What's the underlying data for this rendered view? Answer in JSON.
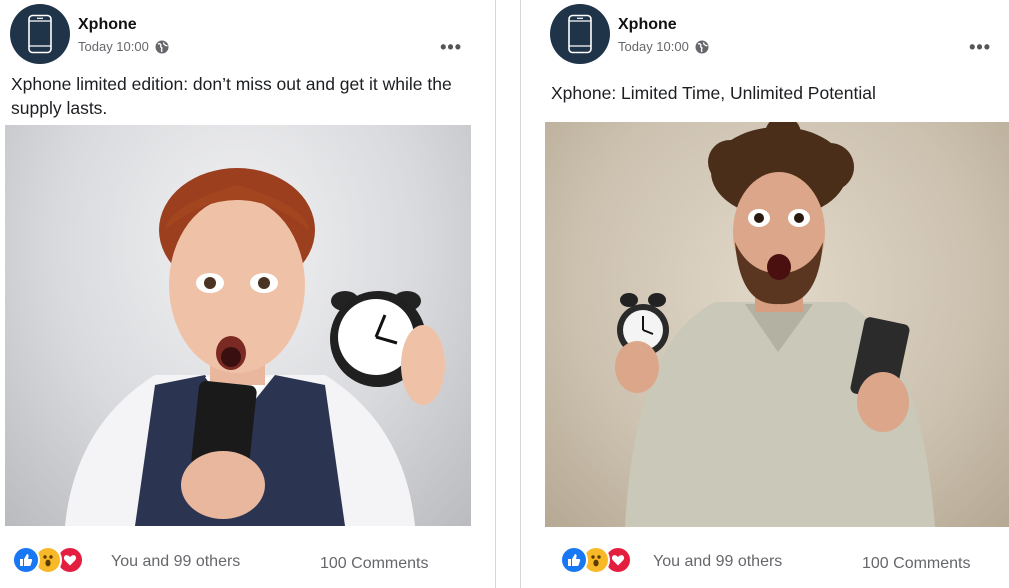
{
  "posts": [
    {
      "author": "Xphone",
      "time": "Today 10:00",
      "caption": "Xphone limited edition: don’t miss out and get it while the supply lasts.",
      "likes_text": "You and 99 others",
      "comments_text": "100 Comments"
    },
    {
      "author": "Xphone",
      "time": "Today 10:00",
      "caption": "Xphone: Limited Time, Unlimited Potential",
      "likes_text": "You and 99 others",
      "comments_text": "100 Comments"
    }
  ],
  "icons": {
    "avatar": "smartphone-icon",
    "audience": "globe-icon",
    "menu": "more-options-icon",
    "reactions": [
      "like-icon",
      "wow-icon",
      "love-icon"
    ]
  },
  "colors": {
    "avatar_bg": "#1f3349",
    "like": "#1877f2",
    "wow": "#f7b928",
    "love": "#e41e3f",
    "muted_text": "#65676b"
  }
}
